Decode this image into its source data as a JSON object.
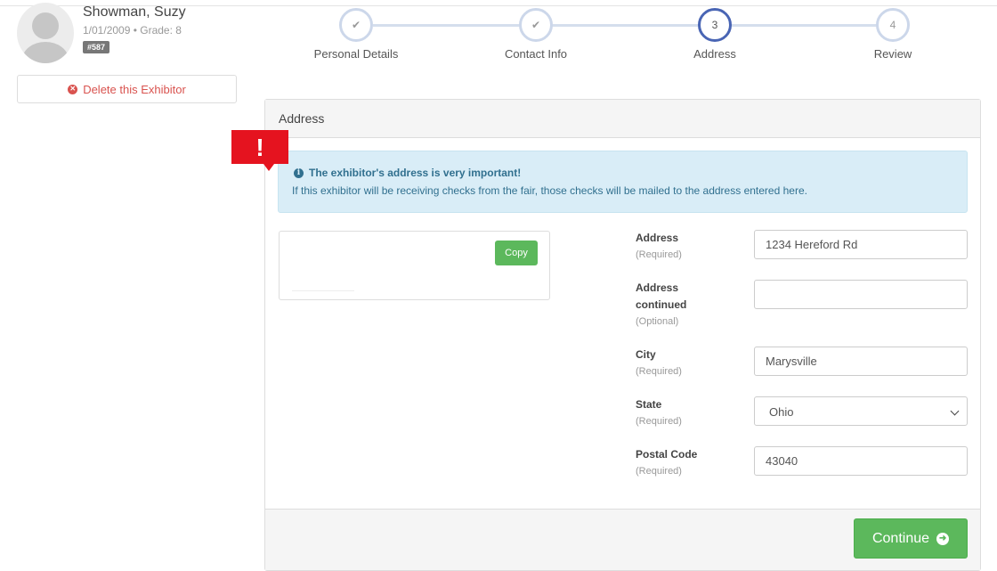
{
  "profile": {
    "name": "Showman, Suzy",
    "meta": "1/01/2009 • Grade: 8",
    "id_badge": "#587",
    "delete_label": "Delete this Exhibitor"
  },
  "stepper": {
    "steps": [
      {
        "label": "Personal Details",
        "marker": "✔",
        "state": "complete"
      },
      {
        "label": "Contact Info",
        "marker": "✔",
        "state": "complete"
      },
      {
        "label": "Address",
        "marker": "3",
        "state": "active"
      },
      {
        "label": "Review",
        "marker": "4",
        "state": "pending"
      }
    ]
  },
  "panel": {
    "title": "Address",
    "alert": {
      "icon": "info-icon",
      "title": "The exhibitor's address is very important!",
      "text": "If this exhibitor will be receiving checks from the fair, those checks will be mailed to the address entered here."
    },
    "copy_label": "Copy",
    "fields": [
      {
        "label": "Address",
        "hint": "(Required)",
        "value": "1234 Hereford Rd"
      },
      {
        "label": "Address continued",
        "hint": "(Optional)",
        "value": ""
      },
      {
        "label": "City",
        "hint": "(Required)",
        "value": "Marysville"
      },
      {
        "label": "State",
        "hint": "(Required)",
        "value": "Ohio"
      },
      {
        "label": "Postal Code",
        "hint": "(Required)",
        "value": "43040"
      }
    ],
    "continue_label": "Continue"
  },
  "annotation": {
    "marker": "!",
    "color": "#e5131f"
  },
  "colors": {
    "success": "#5cb85c",
    "danger": "#d9534f",
    "info_bg": "#d9edf7",
    "info_text": "#31708f",
    "step_active": "#4965b4"
  }
}
